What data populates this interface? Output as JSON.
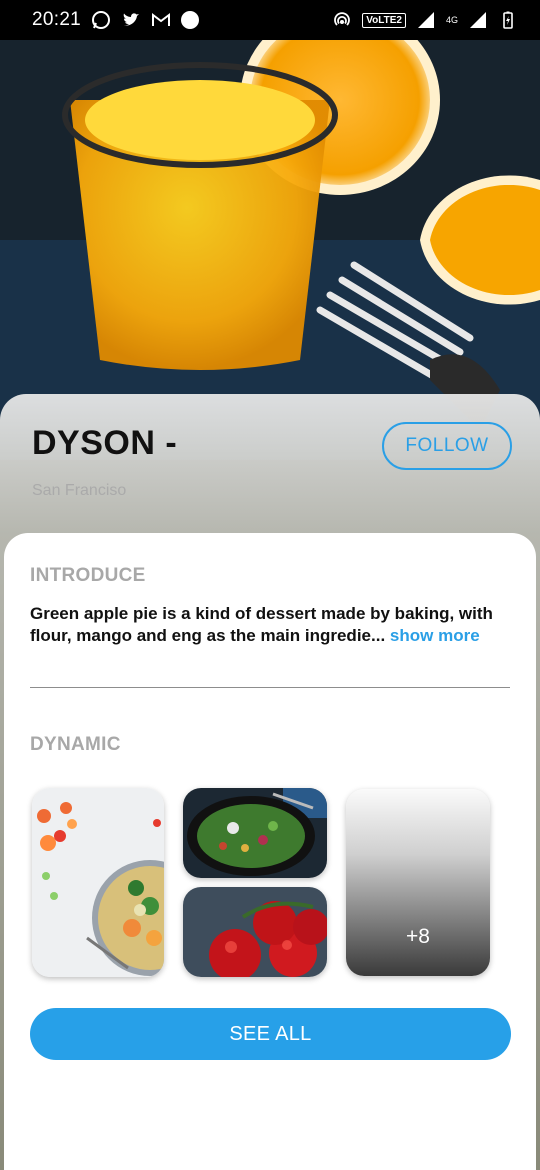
{
  "status_bar": {
    "time": "20:21",
    "volte_label": "VoLTE2",
    "network_label": "4G"
  },
  "profile": {
    "name": "DYSON -",
    "location": "San Franciso",
    "follow_label": "FOLLOW"
  },
  "introduce": {
    "title": "INTRODUCE",
    "text": "Green apple pie is a kind of dessert made by baking, with flour, mango and eng as the main ingredie...",
    "show_more": "show more"
  },
  "dynamic": {
    "title": "DYNAMIC",
    "more_count": "+8",
    "see_all_label": "SEE ALL"
  },
  "colors": {
    "accent": "#2a9fe6",
    "button_blue": "#27a0e8"
  }
}
